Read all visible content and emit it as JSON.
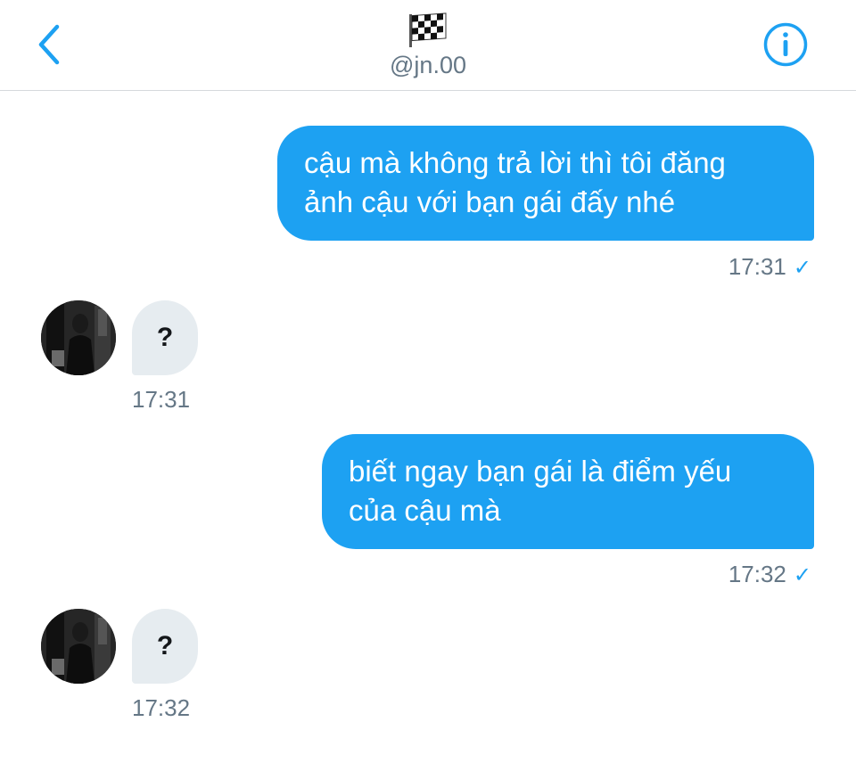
{
  "header": {
    "handle": "@jn.00",
    "back_icon": "chevron-left-icon",
    "flag_icon": "checkered-flag-icon",
    "info_icon": "info-icon"
  },
  "messages": [
    {
      "direction": "outgoing",
      "lines": [
        "cậu mà không trả lời thì tôi đăng",
        "ảnh cậu với bạn gái đấy nhé"
      ],
      "time": "17:31",
      "status": "sent-check-icon"
    },
    {
      "direction": "incoming",
      "text": "?",
      "time": "17:31"
    },
    {
      "direction": "outgoing",
      "lines": [
        "biết ngay bạn gái là điểm yếu",
        "của cậu mà"
      ],
      "time": "17:32",
      "status": "sent-check-icon"
    },
    {
      "direction": "incoming",
      "text": "?",
      "time": "17:32"
    }
  ],
  "colors": {
    "accent": "#1da1f2",
    "incoming_bubble": "#e6ecf0",
    "muted_text": "#657786",
    "divider": "#d6d9dc"
  }
}
